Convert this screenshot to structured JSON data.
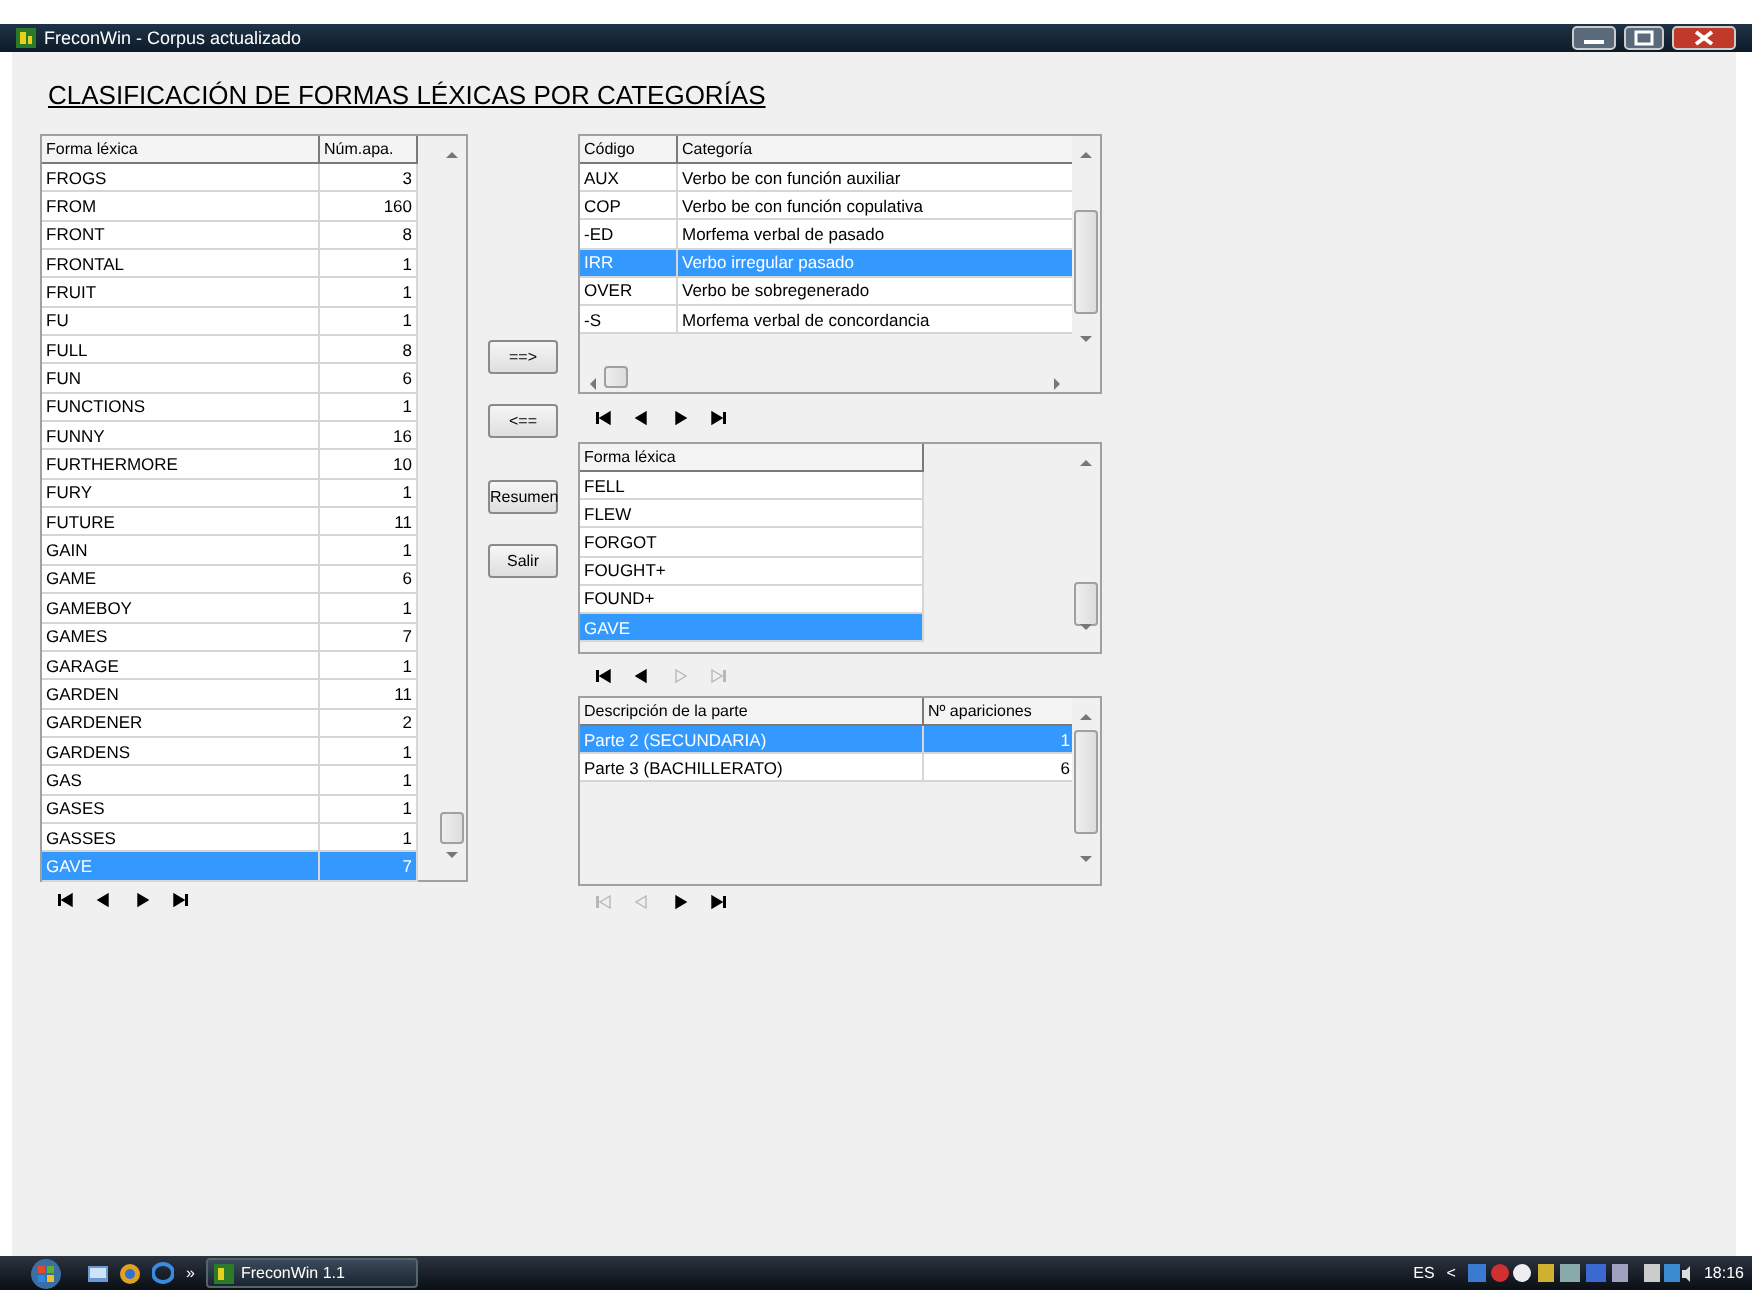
{
  "window": {
    "title": "FreconWin - Corpus actualizado"
  },
  "heading": "CLASIFICACIÓN DE FORMAS LÉXICAS POR CATEGORÍAS",
  "word_table": {
    "columns": [
      "Forma léxica",
      "Núm.apa."
    ],
    "rows": [
      {
        "cells": [
          "FROGS",
          "3"
        ],
        "selected": false
      },
      {
        "cells": [
          "FROM",
          "160"
        ],
        "selected": false
      },
      {
        "cells": [
          "FRONT",
          "8"
        ],
        "selected": false
      },
      {
        "cells": [
          "FRONTAL",
          "1"
        ],
        "selected": false
      },
      {
        "cells": [
          "FRUIT",
          "1"
        ],
        "selected": false
      },
      {
        "cells": [
          "FU",
          "1"
        ],
        "selected": false
      },
      {
        "cells": [
          "FULL",
          "8"
        ],
        "selected": false
      },
      {
        "cells": [
          "FUN",
          "6"
        ],
        "selected": false
      },
      {
        "cells": [
          "FUNCTIONS",
          "1"
        ],
        "selected": false
      },
      {
        "cells": [
          "FUNNY",
          "16"
        ],
        "selected": false
      },
      {
        "cells": [
          "FURTHERMORE",
          "10"
        ],
        "selected": false
      },
      {
        "cells": [
          "FURY",
          "1"
        ],
        "selected": false
      },
      {
        "cells": [
          "FUTURE",
          "11"
        ],
        "selected": false
      },
      {
        "cells": [
          "GAIN",
          "1"
        ],
        "selected": false
      },
      {
        "cells": [
          "GAME",
          "6"
        ],
        "selected": false
      },
      {
        "cells": [
          "GAMEBOY",
          "1"
        ],
        "selected": false
      },
      {
        "cells": [
          "GAMES",
          "7"
        ],
        "selected": false
      },
      {
        "cells": [
          "GARAGE",
          "1"
        ],
        "selected": false
      },
      {
        "cells": [
          "GARDEN",
          "11"
        ],
        "selected": false
      },
      {
        "cells": [
          "GARDENER",
          "2"
        ],
        "selected": false
      },
      {
        "cells": [
          "GARDENS",
          "1"
        ],
        "selected": false
      },
      {
        "cells": [
          "GAS",
          "1"
        ],
        "selected": false
      },
      {
        "cells": [
          "GASES",
          "1"
        ],
        "selected": false
      },
      {
        "cells": [
          "GASSES",
          "1"
        ],
        "selected": false
      },
      {
        "cells": [
          "GAVE",
          "7"
        ],
        "selected": true
      }
    ],
    "navigator": [
      {
        "kind": "first",
        "disabled": false
      },
      {
        "kind": "prev",
        "disabled": false
      },
      {
        "kind": "next",
        "disabled": false
      },
      {
        "kind": "last",
        "disabled": false
      }
    ]
  },
  "buttons": [
    "==>",
    "<==",
    "Resumen",
    "Salir"
  ],
  "category_table": {
    "columns": [
      "Código",
      "Categoría"
    ],
    "rows": [
      {
        "cells": [
          "AUX",
          "Verbo be con función auxiliar"
        ],
        "selected": false
      },
      {
        "cells": [
          "COP",
          "Verbo be con función copulativa"
        ],
        "selected": false
      },
      {
        "cells": [
          "-ED",
          "Morfema verbal de pasado"
        ],
        "selected": false
      },
      {
        "cells": [
          "IRR",
          "Verbo irregular pasado"
        ],
        "selected": true
      },
      {
        "cells": [
          "OVER",
          "Verbo be sobregenerado"
        ],
        "selected": false
      },
      {
        "cells": [
          "-S",
          "Morfema verbal de concordancia"
        ],
        "selected": false
      }
    ],
    "navigator": [
      {
        "kind": "first",
        "disabled": false
      },
      {
        "kind": "prev",
        "disabled": false
      },
      {
        "kind": "next",
        "disabled": false
      },
      {
        "kind": "last",
        "disabled": false
      }
    ]
  },
  "form_table": {
    "columns": [
      "Forma léxica"
    ],
    "rows": [
      {
        "cells": [
          "FELL"
        ],
        "selected": false
      },
      {
        "cells": [
          "FLEW"
        ],
        "selected": false
      },
      {
        "cells": [
          "FORGOT"
        ],
        "selected": false
      },
      {
        "cells": [
          "FOUGHT+"
        ],
        "selected": false
      },
      {
        "cells": [
          "FOUND+"
        ],
        "selected": false
      },
      {
        "cells": [
          "GAVE"
        ],
        "selected": true
      }
    ],
    "navigator": [
      {
        "kind": "first",
        "disabled": false
      },
      {
        "kind": "prev",
        "disabled": false
      },
      {
        "kind": "next",
        "disabled": true
      },
      {
        "kind": "last",
        "disabled": true
      }
    ]
  },
  "part_table": {
    "columns": [
      "Descripción de la parte",
      "Nº apariciones"
    ],
    "rows": [
      {
        "cells": [
          "Parte 2 (SECUNDARIA)",
          "1"
        ],
        "selected": true
      },
      {
        "cells": [
          "Parte 3 (BACHILLERATO)",
          "6"
        ],
        "selected": false
      }
    ],
    "navigator": [
      {
        "kind": "first",
        "disabled": true
      },
      {
        "kind": "prev",
        "disabled": true
      },
      {
        "kind": "next",
        "disabled": false
      },
      {
        "kind": "last",
        "disabled": false
      }
    ]
  },
  "taskbar": {
    "overflow": "»",
    "task": "FreconWin 1.1",
    "language": "ES",
    "tray_expand": "<",
    "clock": "18:16"
  }
}
